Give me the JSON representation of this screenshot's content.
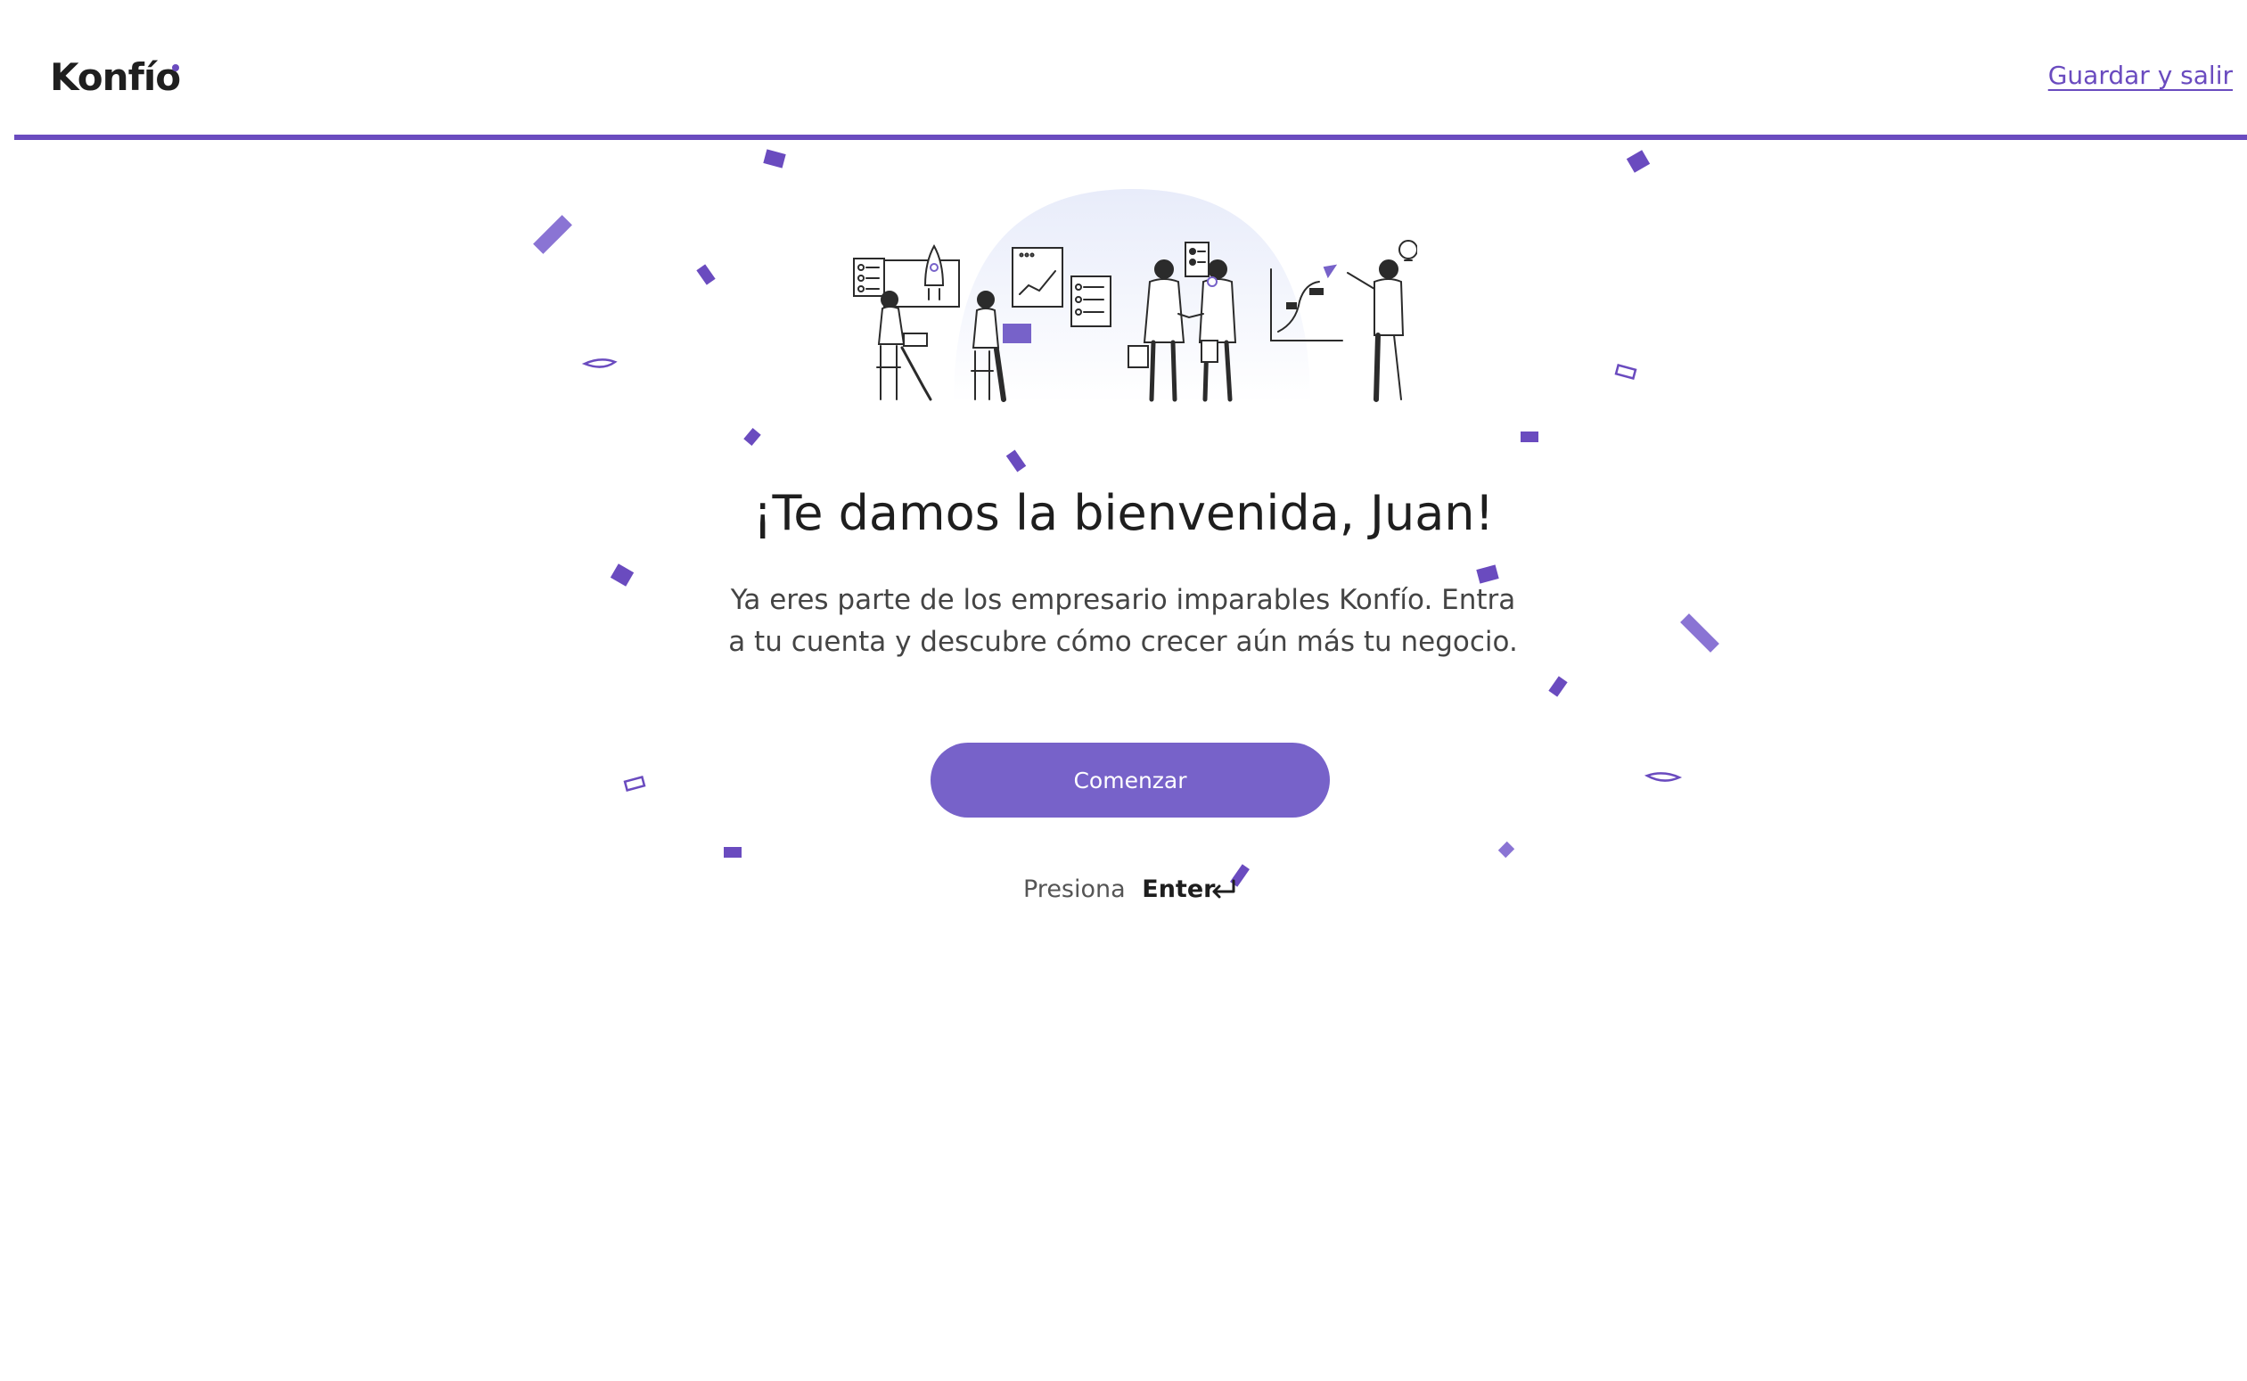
{
  "colors": {
    "accent": "#7762c9",
    "accent_dark": "#6a4bbf",
    "text": "#1e1e1e"
  },
  "header": {
    "logo_text": "Konfío",
    "save_exit_label": "Guardar y salir"
  },
  "main": {
    "title": "¡Te damos la bienvenida, Juan!",
    "description": "Ya eres parte de los empresario imparables Konfío. Entra a tu cuenta y descubre cómo crecer aún más tu negocio.",
    "button_label": "Comenzar",
    "hint_prefix": "Presiona",
    "hint_key": "Enter"
  },
  "icons": {
    "enter": "enter-return-icon",
    "illustration": "team-collaboration-illustration",
    "confetti": "confetti-decoration"
  }
}
